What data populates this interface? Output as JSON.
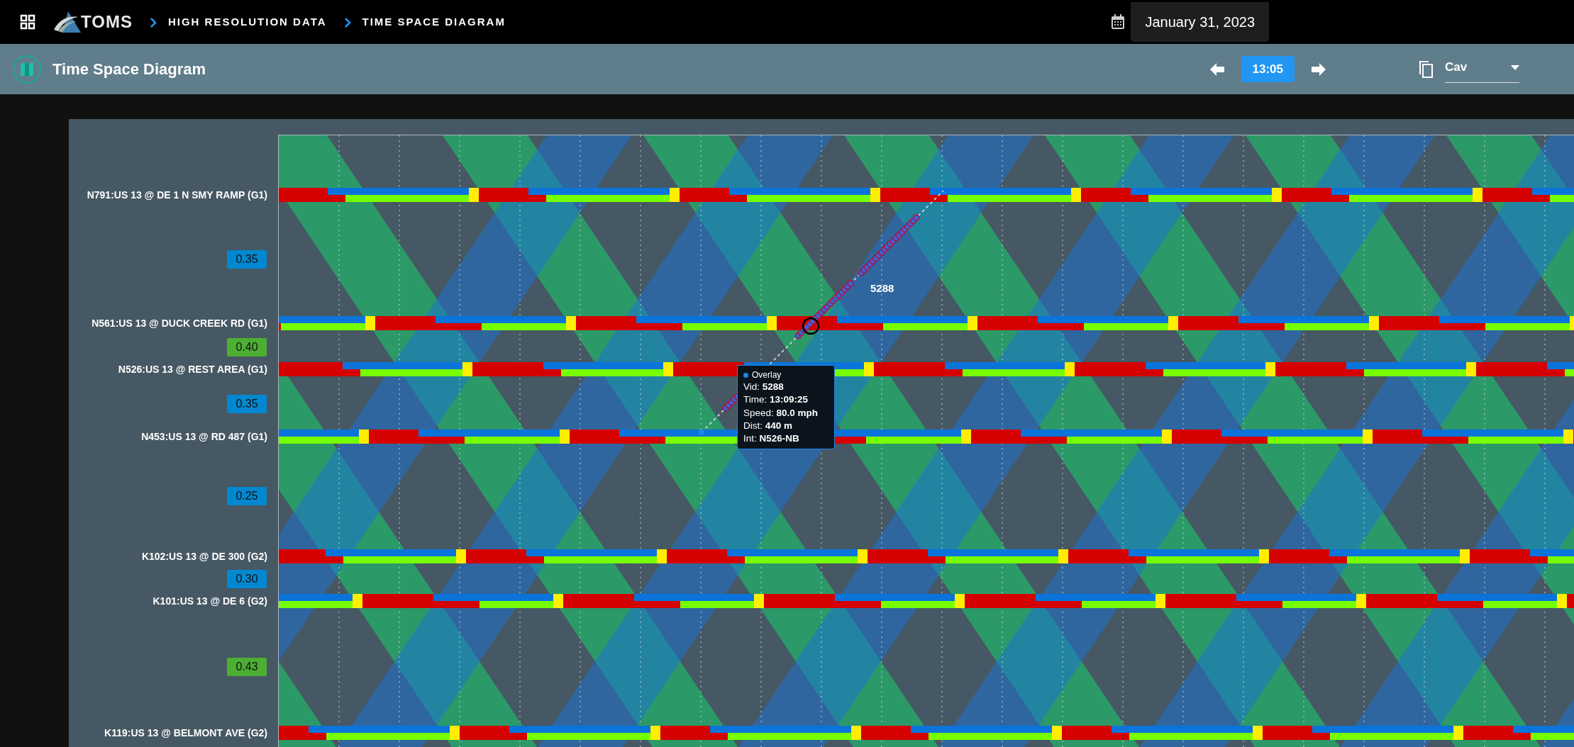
{
  "top_bar": {
    "logo": "TOMS",
    "breadcrumbs": [
      {
        "label": "HIGH RESOLUTION DATA"
      },
      {
        "label": "TIME SPACE DIAGRAM"
      }
    ],
    "date": "January 31, 2023"
  },
  "header": {
    "title": "Time Space Diagram",
    "time": "13:05",
    "dropdown": {
      "value": "Cav"
    }
  },
  "diagram": {
    "intersections": [
      {
        "label": "N791:US 13 @ DE 1 N SMY RAMP (G1)"
      },
      {
        "label": "N561:US 13 @ DUCK CREEK RD (G1)"
      },
      {
        "label": "N526:US 13 @ REST AREA (G1)"
      },
      {
        "label": "N453:US 13 @ RD 487 (G1)"
      },
      {
        "label": "K102:US 13 @ DE 300 (G2)"
      },
      {
        "label": "K101:US 13 @ DE 6 (G2)"
      },
      {
        "label": "K119:US 13 @ BELMONT AVE (G2)"
      }
    ],
    "bandwidths": [
      {
        "value": "0.35",
        "color": "#0288d1"
      },
      {
        "value": "0.40",
        "color": "#4caf33"
      },
      {
        "value": "0.35",
        "color": "#0288d1"
      },
      {
        "value": "0.25",
        "color": "#0288d1"
      },
      {
        "value": "0.30",
        "color": "#0288d1"
      },
      {
        "value": "0.43",
        "color": "#4caf33"
      }
    ],
    "vehicle_label": "5288",
    "tooltip": {
      "title": "Overlay",
      "lines": [
        "Vid: **5288**",
        "Time: **13:09:25**",
        "Speed: **80.0 mph**",
        "Dist: **440 m**",
        "Int: **N526-NB**"
      ]
    }
  }
}
